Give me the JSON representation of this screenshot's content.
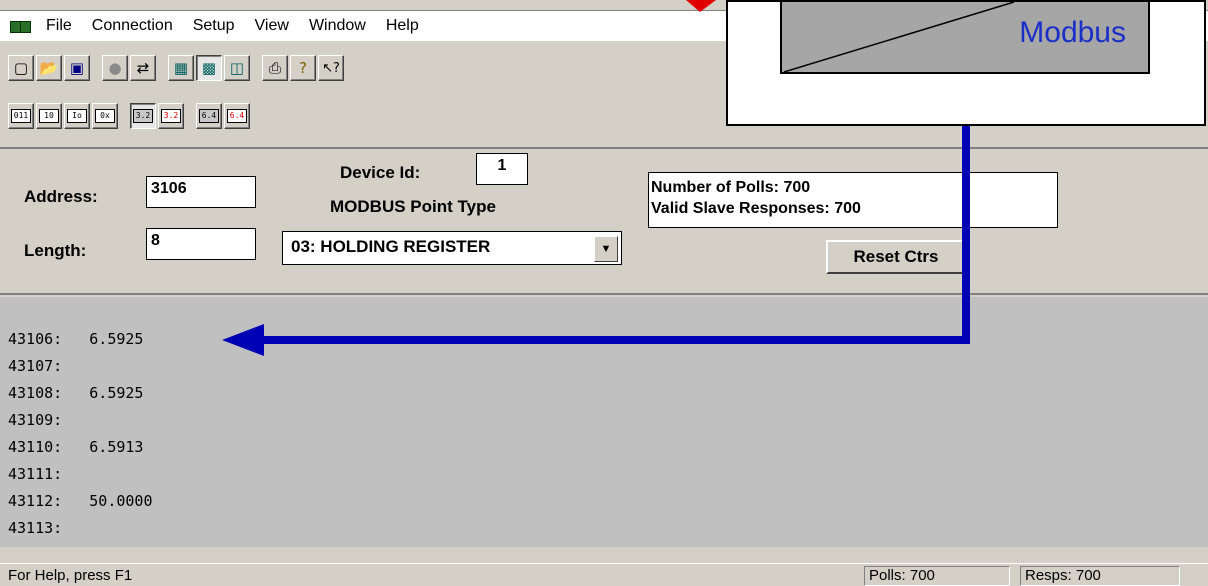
{
  "menu": {
    "items": [
      "File",
      "Connection",
      "Setup",
      "View",
      "Window",
      "Help"
    ]
  },
  "toolbar1": {
    "buttons": [
      "new-icon",
      "open-icon",
      "save-icon",
      "disconnect-icon",
      "connect-icon",
      "poll-definition-icon",
      "display-icon",
      "traffic-icon",
      "print-icon",
      "help-icon",
      "context-help-icon"
    ]
  },
  "toolbar2": {
    "buttons": [
      {
        "name": "binary-format-button",
        "glyph": "011"
      },
      {
        "name": "decimal-format-button",
        "glyph": "10"
      },
      {
        "name": "integer-format-button",
        "glyph": "Io"
      },
      {
        "name": "hex-format-button",
        "glyph": "0x"
      },
      {
        "name": "float-format-button",
        "glyph": "3.2"
      },
      {
        "name": "float-swapped-format-button",
        "glyph": "3.2"
      },
      {
        "name": "double-format-button",
        "glyph": "6.4"
      },
      {
        "name": "double-swapped-format-button",
        "glyph": "6.4"
      }
    ]
  },
  "panel": {
    "address_label": "Address:",
    "address_value": "3106",
    "length_label": "Length:",
    "length_value": "8",
    "device_id_label": "Device Id:",
    "device_id_value": "1",
    "point_type_label": "MODBUS Point Type",
    "point_type_value": "03: HOLDING REGISTER",
    "polls_line": "Number of Polls: 700",
    "responses_line": "Valid Slave Responses: 700",
    "reset_label": "Reset Ctrs"
  },
  "data_rows": [
    {
      "address": "43106:",
      "value": "6.5925"
    },
    {
      "address": "43107:",
      "value": ""
    },
    {
      "address": "43108:",
      "value": "6.5925"
    },
    {
      "address": "43109:",
      "value": ""
    },
    {
      "address": "43110:",
      "value": "6.5913"
    },
    {
      "address": "43111:",
      "value": ""
    },
    {
      "address": "43112:",
      "value": "50.0000"
    },
    {
      "address": "43113:",
      "value": ""
    }
  ],
  "status": {
    "help_text": "For Help, press F1",
    "polls": "Polls: 700",
    "resps": "Resps: 700"
  },
  "callout": {
    "label": "Modbus",
    "color": "#1a2fc8",
    "arrow_color": "#0000b4"
  }
}
